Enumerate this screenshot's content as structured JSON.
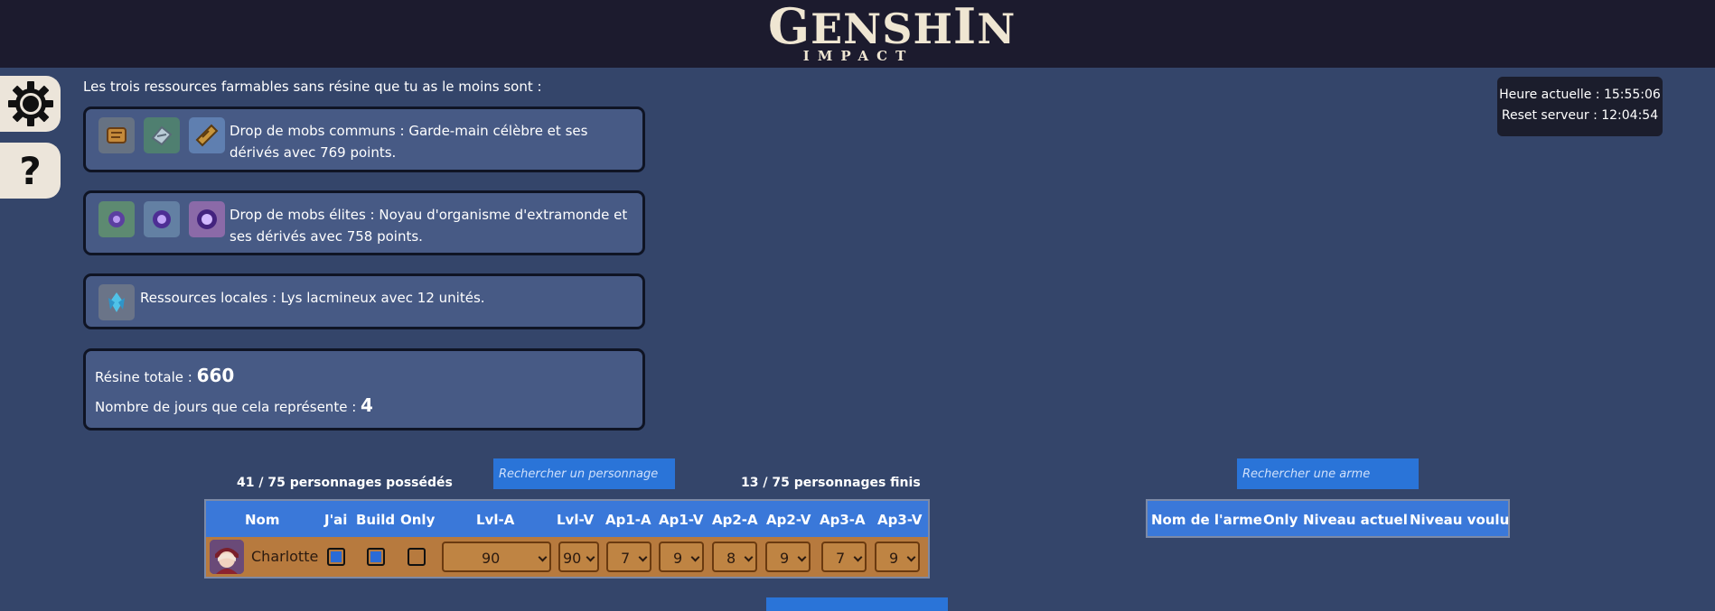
{
  "header": {
    "logo_main_g": "G",
    "logo_main_rest": "ENSH",
    "logo_main_i": "I",
    "logo_main_n": "N",
    "logo_sub": "IMPACT"
  },
  "intro": "Les trois ressources farmables sans résine que tu as le moins sont :",
  "resources": [
    {
      "icons": [
        "scroll-icon",
        "handguard-icon",
        "insignia-icon"
      ],
      "text": "Drop de mobs communs : Garde-main célèbre et ses dérivés avec 769 points."
    },
    {
      "icons": [
        "core-icon",
        "core-icon",
        "core-icon"
      ],
      "text": "Drop de mobs élites : Noyau d'organisme d'extramonde et ses dérivés avec 758 points."
    },
    {
      "icons": [
        "lily-icon"
      ],
      "text": "Ressources locales : Lys lacmineux avec 12 unités."
    }
  ],
  "resin": {
    "total_label": "Résine totale : ",
    "total_value": "660",
    "days_label": "Nombre de jours que cela représente : ",
    "days_value": "4"
  },
  "clock": {
    "current": "Heure actuelle : 15:55:06",
    "reset": "Reset serveur : 12:04:54"
  },
  "characters": {
    "owned": "41 / 75 personnages possédés",
    "finished": "13 / 75 personnages finis",
    "search_placeholder": "Rechercher un personnage",
    "headers": [
      "Nom",
      "J'ai",
      "Build",
      "Only",
      "Lvl-A",
      "Lvl-V",
      "Ap1-A",
      "Ap1-V",
      "Ap2-A",
      "Ap2-V",
      "Ap3-A",
      "Ap3-V"
    ],
    "rows": [
      {
        "name": "Charlotte",
        "have": true,
        "build": true,
        "only": false,
        "lvl_a": "90",
        "lvl_v": "90",
        "ap1_a": "7",
        "ap1_v": "9",
        "ap2_a": "8",
        "ap2_v": "9",
        "ap3_a": "7",
        "ap3_v": "9"
      }
    ]
  },
  "weapons": {
    "search_placeholder": "Rechercher une arme",
    "headers": [
      "Nom de l'arme",
      "Only",
      "Niveau actuel",
      "Niveau voulu"
    ]
  },
  "colors": {
    "background": "#34456a",
    "topbar": "#1c1b2e",
    "table_header": "#3a78d9",
    "row_bg": "#b77a3e"
  }
}
